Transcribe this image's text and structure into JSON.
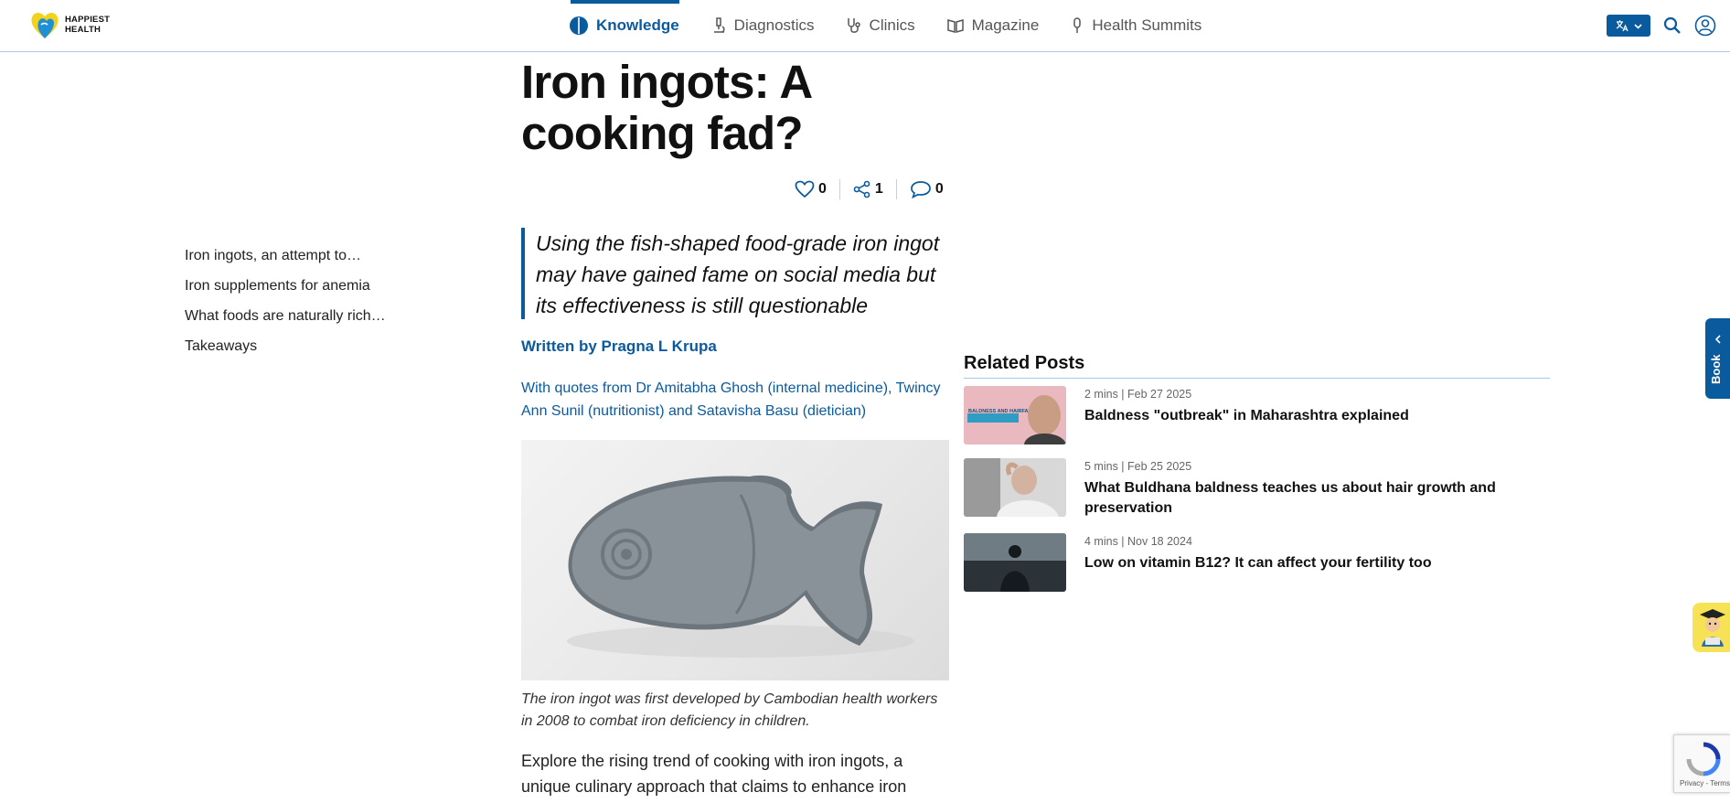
{
  "header": {
    "logo_text_line1": "HAPPIEST",
    "logo_text_line2": "HEALTH",
    "nav": [
      {
        "label": "Knowledge",
        "icon": "brain-icon",
        "active": true
      },
      {
        "label": "Diagnostics",
        "icon": "microscope-icon",
        "active": false
      },
      {
        "label": "Clinics",
        "icon": "stethoscope-icon",
        "active": false
      },
      {
        "label": "Magazine",
        "icon": "book-open-icon",
        "active": false
      },
      {
        "label": "Health Summits",
        "icon": "microphone-icon",
        "active": false
      }
    ],
    "icons": [
      "language-translate-icon",
      "chevron-down-icon",
      "search-icon",
      "user-account-icon"
    ]
  },
  "toc": [
    "Iron ingots, an attempt to…",
    "Iron supplements for anemia",
    "What foods are naturally rich…",
    "Takeaways"
  ],
  "article": {
    "title": "Iron ingots: A cooking fad?",
    "likes": "0",
    "shares": "1",
    "comments": "0",
    "summary": "Using the fish-shaped food-grade iron ingot may have gained fame on social media but its effectiveness is still questionable",
    "author": "Written by Pragna L Krupa",
    "quotes_from": "With quotes from Dr Amitabha Ghosh (internal medicine), Twincy Ann Sunil (nutritionist) and Satavisha Basu (dietician)",
    "image_caption": "The iron ingot was first developed by Cambodian health workers in 2008 to combat iron deficiency in children.",
    "body": "Explore the rising trend of cooking with iron ingots, a unique culinary approach that claims to enhance iron content in food and enhance overall health"
  },
  "related": {
    "heading": "Related Posts",
    "posts": [
      {
        "meta": "2 mins | Feb 27 2025",
        "title": "Baldness \"outbreak\" in Maharashtra explained",
        "thumb_text": "BALDNESS AND HAIRFALL"
      },
      {
        "meta": "5 mins | Feb 25 2025",
        "title": "What Buldhana baldness teaches us about hair growth and preservation"
      },
      {
        "meta": "4 mins | Nov 18 2024",
        "title": "Low on vitamin B12? It can affect your fertility too"
      }
    ]
  },
  "side_tab": {
    "label": "Book"
  },
  "recaptcha": {
    "text": "Privacy - Terms"
  },
  "colors": {
    "brand_blue": "#0a5a9e",
    "rule_blue": "#a9c8e6",
    "bot_yellow": "#f7e154"
  }
}
